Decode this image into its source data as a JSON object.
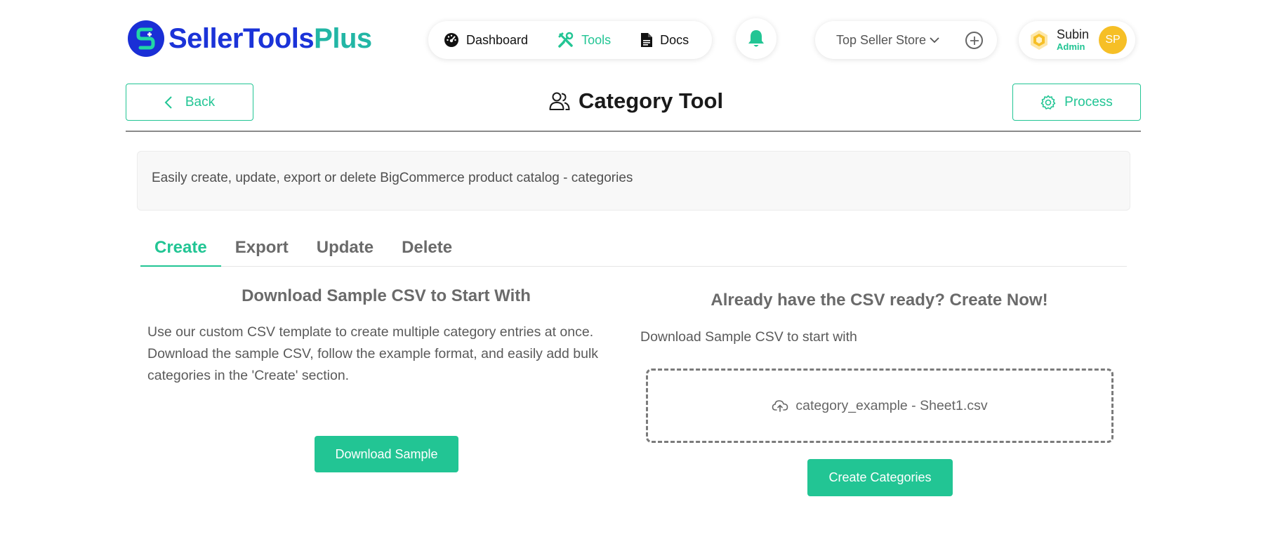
{
  "brand": {
    "name_part1": "SellerTools",
    "name_part2": "Plus"
  },
  "nav": {
    "items": [
      {
        "label": "Dashboard",
        "icon": "dashboard-gauge-icon",
        "active": false
      },
      {
        "label": "Tools",
        "icon": "tools-wrench-icon",
        "active": true
      },
      {
        "label": "Docs",
        "icon": "document-icon",
        "active": false
      }
    ]
  },
  "store": {
    "selected": "Top Seller Store"
  },
  "user": {
    "name": "Subin",
    "role": "Admin",
    "initials": "SP"
  },
  "page": {
    "title": "Category Tool",
    "back_label": "Back",
    "process_label": "Process",
    "description": "Easily create, update, export or delete BigCommerce product catalog - categories"
  },
  "tabs": [
    {
      "label": "Create",
      "active": true
    },
    {
      "label": "Export",
      "active": false
    },
    {
      "label": "Update",
      "active": false
    },
    {
      "label": "Delete",
      "active": false
    }
  ],
  "left_panel": {
    "heading": "Download Sample CSV to Start With",
    "body": "Use our custom CSV template to create multiple category entries at once. Download the sample CSV, follow the example format, and easily add bulk categories in the 'Create' section.",
    "button_label": "Download Sample"
  },
  "right_panel": {
    "heading": "Already have the CSV ready? Create Now!",
    "subtext": "Download Sample CSV to start with",
    "file_name": "category_example - Sheet1.csv",
    "button_label": "Create Categories"
  },
  "colors": {
    "accent": "#22c594",
    "brand_blue": "#1b33d8",
    "brand_teal": "#22b6a5",
    "avatar": "#f6bf26"
  }
}
